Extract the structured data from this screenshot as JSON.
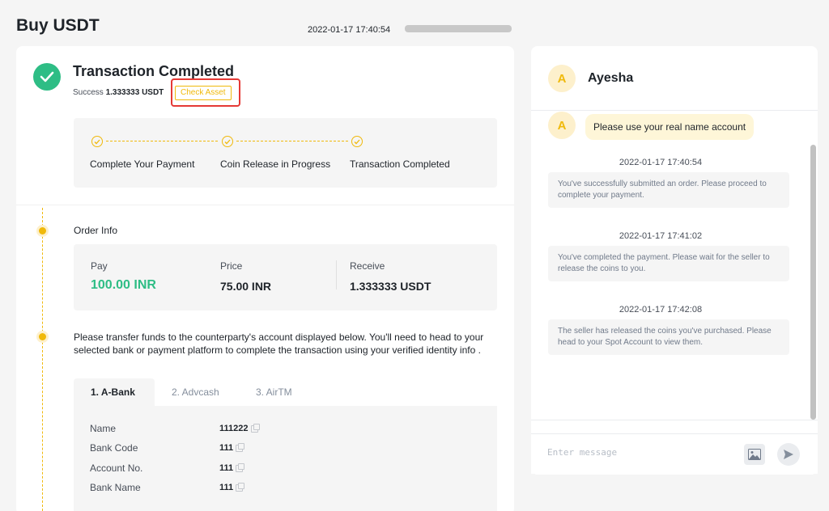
{
  "header": {
    "title": "Buy USDT",
    "timestamp": "2022-01-17 17:40:54"
  },
  "status": {
    "title": "Transaction Completed",
    "success_prefix": "Success",
    "amount": "1.333333 USDT",
    "check_asset_label": "Check Asset"
  },
  "steps": [
    {
      "label": "Complete Your Payment"
    },
    {
      "label": "Coin Release in Progress"
    },
    {
      "label": "Transaction Completed"
    }
  ],
  "order_info": {
    "title": "Order Info",
    "pay_label": "Pay",
    "pay_value": "100.00 INR",
    "price_label": "Price",
    "price_value": "75.00 INR",
    "receive_label": "Receive",
    "receive_value": "1.333333 USDT"
  },
  "instructions": "Please transfer funds to the counterparty's account displayed below. You'll need to head to your selected bank or payment platform to complete the transaction using your verified identity info .",
  "payment_tabs": [
    {
      "label": "1. A-Bank",
      "active": true
    },
    {
      "label": "2. Advcash",
      "active": false
    },
    {
      "label": "3. AirTM",
      "active": false
    }
  ],
  "bank_details": [
    {
      "label": "Name",
      "value": "111222"
    },
    {
      "label": "Bank Code",
      "value": "111"
    },
    {
      "label": "Account No.",
      "value": "111"
    },
    {
      "label": "Bank Name",
      "value": "111"
    }
  ],
  "chat": {
    "avatar_letter": "A",
    "name": "Ayesha",
    "first_message": "Please use your real name account",
    "messages": [
      {
        "time": "2022-01-17 17:40:54",
        "text": "You've successfully submitted an order. Please proceed to complete your payment."
      },
      {
        "time": "2022-01-17 17:41:02",
        "text": "You've completed the payment. Please wait for the seller to release the coins to you."
      },
      {
        "time": "2022-01-17 17:42:08",
        "text": "The seller has released the coins you've purchased. Please head to your Spot Account to view them."
      }
    ],
    "input_placeholder": "Enter message"
  },
  "colors": {
    "accent": "#f0b90b",
    "success": "#2ebd85",
    "highlight": "#e53935"
  },
  "icons": {
    "status": "checkmark-icon",
    "step": "check-circle-icon",
    "copy": "copy-icon",
    "image": "image-icon",
    "send": "send-icon"
  }
}
